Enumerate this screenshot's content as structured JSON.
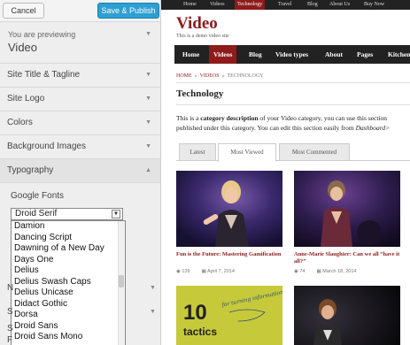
{
  "customizer": {
    "cancel_label": "Cancel",
    "save_label": "Save & Publish",
    "previewing_label": "You are previewing",
    "theme_name": "Video",
    "sections": [
      {
        "label": "Site Title & Tagline"
      },
      {
        "label": "Site Logo"
      },
      {
        "label": "Colors"
      },
      {
        "label": "Background Images"
      },
      {
        "label": "Typography"
      }
    ],
    "typography": {
      "google_fonts_label": "Google Fonts",
      "selected_font": "Droid Serif",
      "font_options": [
        "Damion",
        "Dancing Script",
        "Dawning of a New Day",
        "Days One",
        "Delius",
        "Delius Swash Caps",
        "Delius Unicase",
        "Didact Gothic",
        "Dorsa",
        "Droid Sans",
        "Droid Sans Mono"
      ]
    },
    "partially_hidden_letters": [
      "N",
      "S",
      "S",
      "F"
    ]
  },
  "site": {
    "topnav": [
      "Home",
      "Videos",
      "Technology",
      "Travel",
      "Blog",
      "About Us",
      "Buy Now"
    ],
    "title": "Video",
    "tagline": "This is a demo video site",
    "menu": [
      "Home",
      "Videos",
      "Blog",
      "Video types",
      "About",
      "Pages",
      "Kitchen"
    ],
    "breadcrumb": [
      "HOME",
      "VIDEOS",
      "TECHNOLOGY"
    ],
    "page_title": "Technology",
    "description": {
      "line1_a": "This is a ",
      "line1_b": "category description",
      "line1_c": " of your Video category, you can use this section",
      "line2_a": "published under this category. You can edit this section easily from ",
      "line2_b": "Dashboard>"
    },
    "tabs": [
      "Latest",
      "Most Viewed",
      "Most Commented"
    ],
    "active_tab": "Most Viewed",
    "cards": [
      {
        "title": "Fun is the Future: Mastering Gamification",
        "views": "139",
        "date": "April 7, 2014"
      },
      {
        "title": "Anne-Marie Slaughter: Can we all “have it all?”",
        "views": "74",
        "date": "March 18, 2014"
      },
      {
        "title": "",
        "views": "",
        "date": ""
      },
      {
        "title": "",
        "views": "",
        "date": ""
      }
    ],
    "card3_graphic": {
      "number": "10",
      "word": "tactics",
      "script": "for turning information into action"
    }
  },
  "colors": {
    "accent_red": "#8e1b1b",
    "save_blue": "#2e9fd2",
    "dark_nav": "#222222"
  }
}
